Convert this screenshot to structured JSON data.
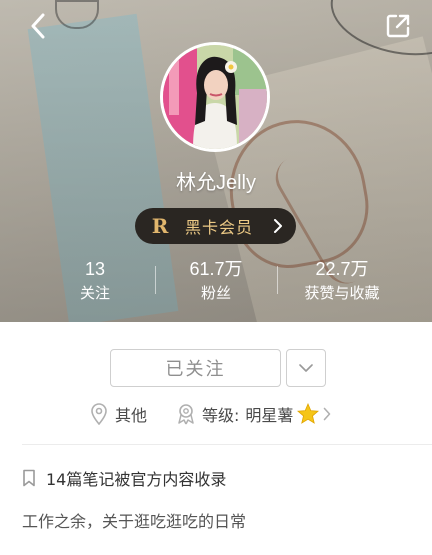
{
  "profile": {
    "username": "林允Jelly",
    "vip": {
      "icon_letter": "R",
      "label": "黑卡会员"
    }
  },
  "stats": [
    {
      "value": "13",
      "label": "关注"
    },
    {
      "value": "61.7万",
      "label": "粉丝"
    },
    {
      "value": "22.7万",
      "label": "获赞与收藏"
    }
  ],
  "actions": {
    "follow_label": "已关注"
  },
  "info": {
    "location": "其他",
    "level_prefix": "等级:",
    "level_value": "明星薯"
  },
  "collected": {
    "text": "14篇笔记被官方内容收录"
  },
  "bio": "工作之余，关于逛吃逛吃的日常",
  "colors": {
    "vip_gold": "#ecc985",
    "vip_bg": "#2a2622",
    "star": "#f5c518"
  }
}
